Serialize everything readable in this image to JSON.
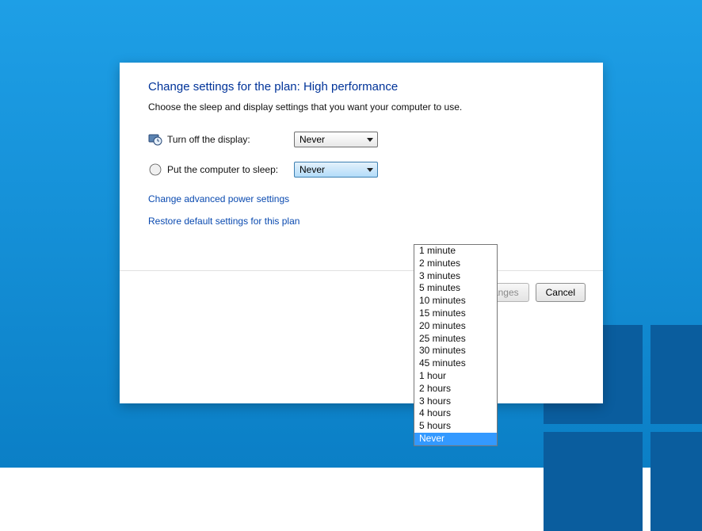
{
  "title": "Change settings for the plan: High performance",
  "subtitle": "Choose the sleep and display settings that you want your computer to use.",
  "rows": {
    "display": {
      "label": "Turn off the display:",
      "value": "Never"
    },
    "sleep": {
      "label": "Put the computer to sleep:",
      "value": "Never"
    }
  },
  "links": {
    "advanced": "Change advanced power settings",
    "restore": "Restore default settings for this plan"
  },
  "buttons": {
    "save": "Save changes",
    "cancel": "Cancel"
  },
  "sleep_options": [
    "1 minute",
    "2 minutes",
    "3 minutes",
    "5 minutes",
    "10 minutes",
    "15 minutes",
    "20 minutes",
    "25 minutes",
    "30 minutes",
    "45 minutes",
    "1 hour",
    "2 hours",
    "3 hours",
    "4 hours",
    "5 hours",
    "Never"
  ],
  "sleep_selected_index": 15
}
